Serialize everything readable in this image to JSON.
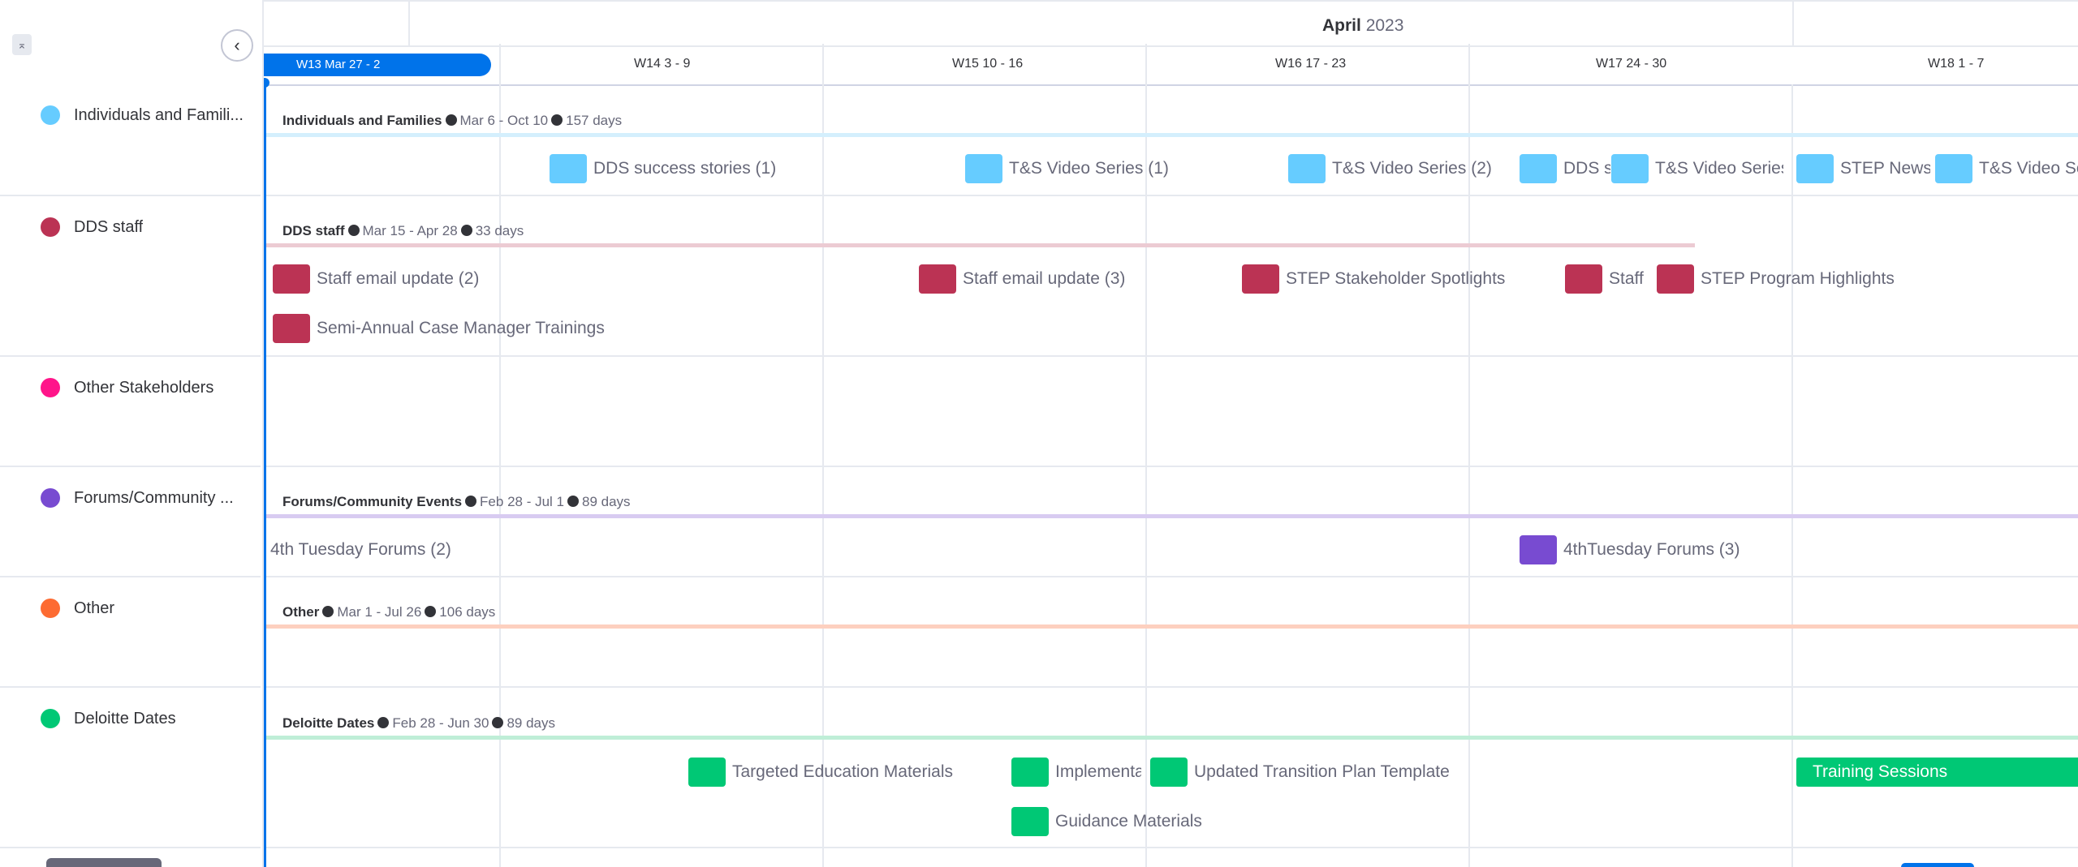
{
  "colors": {
    "individuals": "#66ccff",
    "dds_staff": "#bb3354",
    "other_stakeholders": "#ff158a",
    "forums": "#784bd1",
    "other": "#fd6b32",
    "deloitte": "#00c875",
    "accent": "#0073ea"
  },
  "header": {
    "month": "April",
    "year": "2023",
    "current_week": "W13 Mar 27 - 2",
    "weeks": [
      "W14 3 - 9",
      "W15 10 - 16",
      "W16 17 - 23",
      "W17 24 - 30",
      "W18 1 - 7"
    ]
  },
  "icons": {
    "collapse": "chevrons-collapse-icon",
    "back": "chevron-left-icon"
  },
  "groups": [
    {
      "name": "Individuals and Famili...",
      "summary_name": "Individuals and Families",
      "dates": "Mar 6 - Oct 10",
      "duration": "157 days"
    },
    {
      "name": "DDS staff",
      "summary_name": "DDS staff",
      "dates": "Mar 15 - Apr 28",
      "duration": "33 days"
    },
    {
      "name": "Other Stakeholders"
    },
    {
      "name": "Forums/Community ...",
      "summary_name": "Forums/Community Events",
      "dates": "Feb 28 - Jul 1",
      "duration": "89 days"
    },
    {
      "name": "Other",
      "summary_name": "Other",
      "dates": "Mar 1 - Jul 26",
      "duration": "106 days"
    },
    {
      "name": "Deloitte Dates",
      "summary_name": "Deloitte Dates",
      "dates": "Feb 28 - Jun 30",
      "duration": "89 days"
    }
  ],
  "items": {
    "individuals": [
      "DDS success stories (1)",
      "T&S Video Series (1)",
      "T&S Video Series (2)",
      "DDS s",
      "T&S Video Series",
      "STEP News",
      "T&S Video Se"
    ],
    "dds_staff": [
      "Staff email update (2)",
      "Staff email update (3)",
      "STEP Stakeholder Spotlights",
      "Staff",
      "STEP Program Highlights",
      "Semi-Annual Case Manager Trainings"
    ],
    "forums": [
      "4th Tuesday Forums (2)",
      "4thTuesday Forums (3)"
    ],
    "deloitte": [
      "Targeted Education Materials",
      "Implementa",
      "Updated Transition Plan Template",
      "Training Sessions",
      "Guidance Materials"
    ]
  }
}
